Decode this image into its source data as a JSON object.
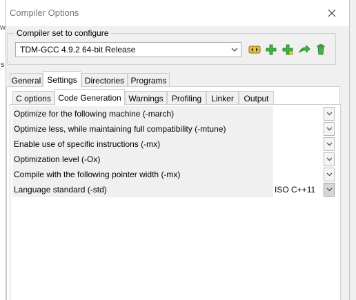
{
  "background": {
    "fragment_top": "w",
    "fragment_mid": "s"
  },
  "window": {
    "title": "Compiler Options"
  },
  "compiler_set": {
    "group_label": "Compiler set to configure",
    "selected": "TDM-GCC 4.9.2 64-bit Release"
  },
  "main_tabs": [
    {
      "label": "General"
    },
    {
      "label": "Settings"
    },
    {
      "label": "Directories"
    },
    {
      "label": "Programs"
    }
  ],
  "sub_tabs": [
    {
      "label": "C options"
    },
    {
      "label": "Code Generation"
    },
    {
      "label": "Warnings"
    },
    {
      "label": "Profiling"
    },
    {
      "label": "Linker"
    },
    {
      "label": "Output"
    }
  ],
  "options": [
    {
      "label": "Optimize for the following machine (-march)",
      "value": ""
    },
    {
      "label": "Optimize less, while maintaining full compatibility (-mtune)",
      "value": ""
    },
    {
      "label": "Enable use of specific instructions (-mx)",
      "value": ""
    },
    {
      "label": "Optimization level (-Ox)",
      "value": ""
    },
    {
      "label": "Compile with the following pointer width (-mx)",
      "value": ""
    },
    {
      "label": "Language standard (-std)",
      "value": "ISO C++11"
    }
  ]
}
